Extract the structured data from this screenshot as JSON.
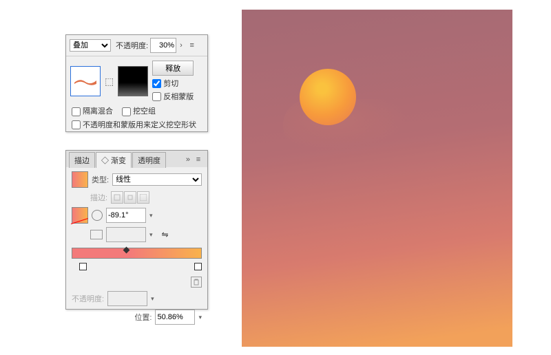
{
  "transparency": {
    "blend_mode": "叠加",
    "opacity_label": "不透明度:",
    "opacity_value": "30%",
    "release_btn": "释放",
    "clip_label": "剪切",
    "clip_checked": true,
    "invert_label": "反相蒙版",
    "invert_checked": false,
    "isolate_label": "隔离混合",
    "knockout_label": "挖空组",
    "define_label": "不透明度和蒙版用来定义挖空形状"
  },
  "gradient": {
    "tabs": [
      "描边",
      "◇ 渐变",
      "透明度"
    ],
    "type_label": "类型:",
    "type_value": "线性",
    "stroke_label": "描边:",
    "angle_value": "-89.1°",
    "aspect_value": "",
    "opacity_label": "不透明度:",
    "opacity_value": "",
    "location_label": "位置:",
    "location_value": "50.86%"
  },
  "chart_data": {
    "type": "area",
    "title": "",
    "note": "Gradient sunset artwork with sun and cloud; not a data chart",
    "series": []
  }
}
